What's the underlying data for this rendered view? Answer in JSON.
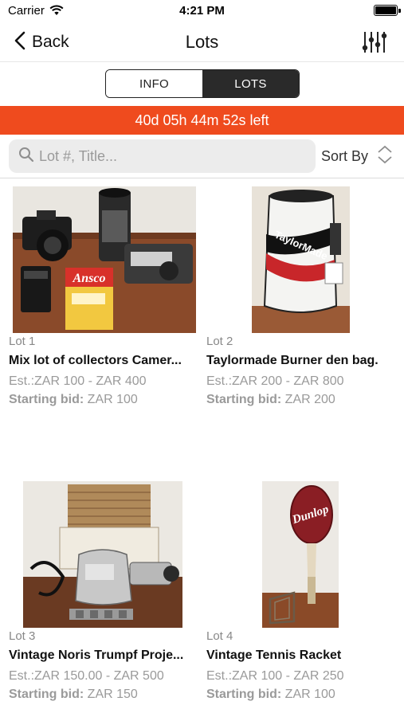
{
  "status": {
    "carrier": "Carrier",
    "time": "4:21 PM"
  },
  "nav": {
    "back_label": "Back",
    "title": "Lots"
  },
  "tabs": [
    {
      "label": "INFO",
      "active": false
    },
    {
      "label": "LOTS",
      "active": true
    }
  ],
  "countdown": {
    "text": "40d 05h 44m 52s left",
    "color": "#ef4b1e"
  },
  "search": {
    "placeholder": "Lot #, Title..."
  },
  "sort": {
    "label": "Sort By"
  },
  "lots": [
    {
      "number": "Lot 1",
      "title": "Mix lot of collectors Camer...",
      "estimate": "Est.:ZAR 100 - ZAR 400",
      "starting_label": "Starting bid:",
      "starting_value": "ZAR 100"
    },
    {
      "number": "Lot 2",
      "title": "Taylormade Burner den bag.",
      "estimate": "Est.:ZAR 200 - ZAR 800",
      "starting_label": "Starting bid:",
      "starting_value": "ZAR 200"
    },
    {
      "number": "Lot 3",
      "title": "Vintage Noris Trumpf Proje...",
      "estimate": "Est.:ZAR 150.00 - ZAR 500",
      "starting_label": "Starting bid:",
      "starting_value": "ZAR 150"
    },
    {
      "number": "Lot 4",
      "title": "Vintage Tennis Racket",
      "estimate": "Est.:ZAR 100 - ZAR 250",
      "starting_label": "Starting bid:",
      "starting_value": "ZAR 100"
    }
  ],
  "image_text": {
    "ansco": "Ansco",
    "taylormade": "TaylorMade",
    "dunlop": "Dunlop"
  }
}
